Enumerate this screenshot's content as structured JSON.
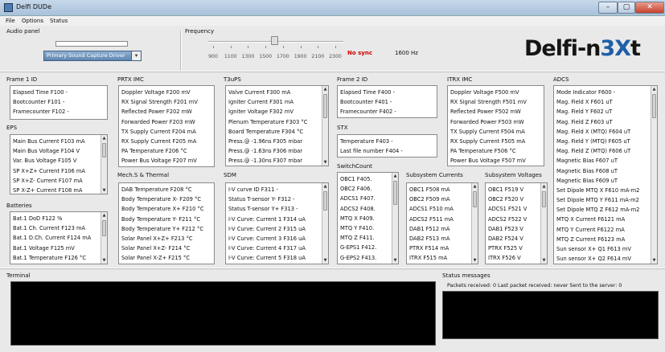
{
  "window": {
    "title": "Delfi DUDe",
    "min_label": "–",
    "max_label": "▢",
    "close_label": "✕"
  },
  "menu": [
    "File",
    "Options",
    "Status"
  ],
  "audio": {
    "title": "Audio panel",
    "driver": "Primary Sound Capture Driver",
    "dropdown_arrow": "▾"
  },
  "frequency": {
    "title": "Frequency",
    "ticks": [
      "900",
      "1100",
      "1300",
      "1500",
      "1700",
      "1900",
      "2100",
      "2300"
    ],
    "sync": "No sync",
    "value": "1600 Hz",
    "sync_color": "#d00000"
  },
  "logo": {
    "text": "Delfi-n3Xt"
  },
  "panels": {
    "frame1": {
      "title": "Frame 1 ID",
      "items": [
        "Elapsed Time F100 -",
        "Bootcounter F101 -",
        "Framecounter F102 -"
      ]
    },
    "eps": {
      "title": "EPS",
      "items": [
        "Main Bus Current F103 mA",
        "Main Bus Voltage F104 V",
        "Var. Bus Voltage F105 V",
        "SP X+Z+ Current F106 mA",
        "SP X+Z- Current F107 mA",
        "SP X-Z+ Current F108 mA"
      ]
    },
    "batteries": {
      "title": "Batteries",
      "items": [
        "Bat.1 DoD F122 %",
        "Bat.1 Ch. Current F123 mA",
        "Bat.1 D.Ch. Current F124 mA",
        "Bat.1 Voltage F125 mV",
        "Bat.1 Temperature F126 °C"
      ]
    },
    "prtx": {
      "title": "PRTX IMC",
      "items": [
        "Doppler Voltage F200 mV",
        "RX Signal Strength F201 mV",
        "Reflected Power F202 mW",
        "Forwarded Power F203 mW",
        "TX Supply Current F204 mA",
        "RX Supply Current F205 mA",
        "PA Temperature F206 °C",
        "Power Bus Voltage F207 mV"
      ]
    },
    "mech": {
      "title": "Mech.S & Thermal",
      "items": [
        "DAB Temperature F208 °C",
        "Body Temperature X- F209 °C",
        "Body Temperature X+ F210 °C",
        "Body Temperature Y- F211 °C",
        "Body Temperature Y+ F212 °C",
        "Solar Panel X+Z+ F213 °C",
        "Solar Panel X+Z- F214 °C",
        "Solar Panel X-Z+ F215 °C"
      ]
    },
    "t3ups": {
      "title": "T3uPS",
      "items": [
        "Valve Current F300 mA",
        "Igniter Current F301 mA",
        "Igniter Voltage F302 mV",
        "Plenum Temperature F303 °C",
        "Board Temperature F304 °C",
        "Press.@ -1.96ns F305 mbar",
        "Press.@ -1.63ns F306 mbar",
        "Press.@ -1.30ns F307 mbar"
      ]
    },
    "sdm": {
      "title": "SDM",
      "items": [
        "I-V curve ID F311 -",
        "Status T-sensor Y- F312 -",
        "Status T-sensor Y+ F313 -",
        "I-V Curve: Current 1 F314 uA",
        "I-V Curve: Current 2 F315 uA",
        "I-V Curve: Current 3 F316 uA",
        "I-V Curve: Current 4 F317 uA",
        "I-V Curve: Current 5 F318 uA"
      ]
    },
    "frame2": {
      "title": "Frame 2 ID",
      "items": [
        "Elapsed Time F400 -",
        "Bootcounter F401 -",
        "Framecounter F402 -"
      ]
    },
    "stx": {
      "title": "STX",
      "items": [
        "Temperature F403 -",
        "Last file number F404 -"
      ]
    },
    "switchcount": {
      "title": "SwitchCount",
      "items": [
        "OBC1 F405.",
        "OBC2 F406.",
        "ADCS1 F407.",
        "ADCS2 F408.",
        "MTQ X F409.",
        "MTQ Y F410.",
        "MTQ Z F411.",
        "G-EPS1 F412.",
        "G-EPS2 F413."
      ]
    },
    "subcurrents": {
      "title": "Subsystem Currents",
      "items": [
        "OBC1 F508 mA",
        "OBC2 F509 mA",
        "ADCS1 F510 mA",
        "ADCS2 F511 mA",
        "DAB1 F512 mA",
        "DAB2 F513 mA",
        "PTRX F514 mA",
        "ITRX F515 mA"
      ]
    },
    "itrx": {
      "title": "ITRX IMC",
      "items": [
        "Doppler Voltage F500 mV",
        "RX Signal Strength F501 mV",
        "Reflected Power F502 mW",
        "Forwarded Power F503 mW",
        "TX Supply Current F504 mA",
        "RX Supply Current F505 mA",
        "PA Temperature F506 °C",
        "Power Bus Voltage F507 mV"
      ]
    },
    "subvoltages": {
      "title": "Subsystem Voltages",
      "items": [
        "OBC1 F519 V",
        "OBC2 F520 V",
        "ADCS1 F521 V",
        "ADCS2 F522 V",
        "DAB1 F523 V",
        "DAB2 F524 V",
        "PTRX F525 V",
        "ITRX F526 V"
      ]
    },
    "adcs": {
      "title": "ADCS",
      "items": [
        "Mode Indicator F600 -",
        "Mag. Field X F601 uT",
        "Mag. Field Y F602 uT",
        "Mag. Field Z F603 uT",
        "Mag. Field X (MTQ) F604 uT",
        "Mag. Field Y (MTQ) F605 uT",
        "Mag. Field Z (MTQ) F606 uT",
        "Magnetic Bias F607 uT",
        "Magnetic Bias F608 uT",
        "Magnetic Bias F609 uT",
        "Set Dipole MTQ X F610 mA-m2",
        "Set Dipole MTQ Y F611 mA-m2",
        "Set Dipole MTQ Z F612 mA-m2",
        "MTQ X Current F6121 mA",
        "MTQ Y Current F6122 mA",
        "MTQ Z Current F6123 mA",
        "Sun sensor X+ Q1 F613 mV",
        "Sun sensor X+ Q2 F614 mV"
      ]
    }
  },
  "terminal": {
    "title": "Terminal"
  },
  "status": {
    "title": "Status messages",
    "text": "Packets received: 0  Last packet received: never  Sent to the server: 0"
  }
}
